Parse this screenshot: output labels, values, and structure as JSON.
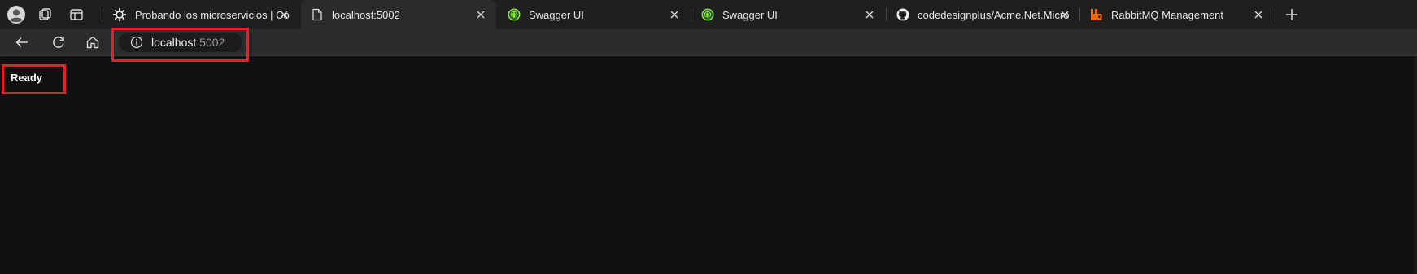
{
  "tabs": [
    {
      "title": "Probando los microservicios | Codi",
      "icon": "gear-icon"
    },
    {
      "title": "localhost:5002",
      "icon": "page-icon",
      "active": true
    },
    {
      "title": "Swagger UI",
      "icon": "swagger-icon"
    },
    {
      "title": "Swagger UI",
      "icon": "swagger-icon"
    },
    {
      "title": "codedesignplus/Acme.Net.Micros",
      "icon": "github-icon"
    },
    {
      "title": "RabbitMQ Management",
      "icon": "rabbitmq-icon"
    }
  ],
  "address": {
    "host": "localhost",
    "port": ":5002"
  },
  "content": {
    "status_text": "Ready"
  },
  "colors": {
    "annotation": "#e3202b",
    "swagger": "#85ea2d",
    "rabbitmq": "#ff6600"
  }
}
